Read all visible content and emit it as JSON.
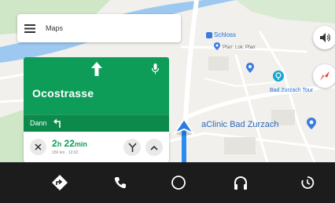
{
  "header": {
    "app_title": "Maps",
    "menu_icon": "menu-icon"
  },
  "navigation": {
    "maneuver_icon": "straight-arrow-icon",
    "mic_icon": "mic-icon",
    "street": "Ocostrasse",
    "then_label": "Dann",
    "then_icon": "turn-left-icon"
  },
  "eta": {
    "close_icon": "close-icon",
    "hours": "2",
    "hours_unit": "h",
    "minutes": "22",
    "minutes_unit": "min",
    "detail": "150 km · 12:02",
    "options_icon": "route-options-icon",
    "expand_icon": "chevron-up-icon",
    "accent_color": "#0d9d58"
  },
  "map": {
    "labels": {
      "museum": "Schloss",
      "hotel": "Pfarr. Lok. Pfarr",
      "bad_zurzach": "Bad Zurzach Tour",
      "clinic": "aClinic Bad Zurzach"
    }
  },
  "controls": {
    "volume_icon": "volume-icon",
    "compass_icon": "compass-icon"
  },
  "bottom_bar": {
    "items": [
      {
        "name": "navigation",
        "icon": "navigation-icon"
      },
      {
        "name": "phone",
        "icon": "phone-icon"
      },
      {
        "name": "home",
        "icon": "home-icon"
      },
      {
        "name": "music",
        "icon": "headphones-icon"
      },
      {
        "name": "notifications",
        "icon": "recent-icon"
      }
    ],
    "bg_color": "#1c1c1c"
  }
}
